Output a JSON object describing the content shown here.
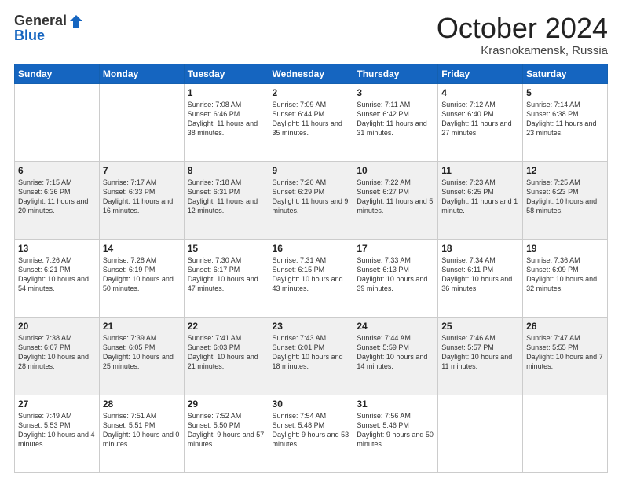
{
  "header": {
    "logo_general": "General",
    "logo_blue": "Blue",
    "month": "October 2024",
    "location": "Krasnokamensk, Russia"
  },
  "days_of_week": [
    "Sunday",
    "Monday",
    "Tuesday",
    "Wednesday",
    "Thursday",
    "Friday",
    "Saturday"
  ],
  "weeks": [
    [
      {
        "day": "",
        "sunrise": "",
        "sunset": "",
        "daylight": ""
      },
      {
        "day": "",
        "sunrise": "",
        "sunset": "",
        "daylight": ""
      },
      {
        "day": "1",
        "sunrise": "Sunrise: 7:08 AM",
        "sunset": "Sunset: 6:46 PM",
        "daylight": "Daylight: 11 hours and 38 minutes."
      },
      {
        "day": "2",
        "sunrise": "Sunrise: 7:09 AM",
        "sunset": "Sunset: 6:44 PM",
        "daylight": "Daylight: 11 hours and 35 minutes."
      },
      {
        "day": "3",
        "sunrise": "Sunrise: 7:11 AM",
        "sunset": "Sunset: 6:42 PM",
        "daylight": "Daylight: 11 hours and 31 minutes."
      },
      {
        "day": "4",
        "sunrise": "Sunrise: 7:12 AM",
        "sunset": "Sunset: 6:40 PM",
        "daylight": "Daylight: 11 hours and 27 minutes."
      },
      {
        "day": "5",
        "sunrise": "Sunrise: 7:14 AM",
        "sunset": "Sunset: 6:38 PM",
        "daylight": "Daylight: 11 hours and 23 minutes."
      }
    ],
    [
      {
        "day": "6",
        "sunrise": "Sunrise: 7:15 AM",
        "sunset": "Sunset: 6:36 PM",
        "daylight": "Daylight: 11 hours and 20 minutes."
      },
      {
        "day": "7",
        "sunrise": "Sunrise: 7:17 AM",
        "sunset": "Sunset: 6:33 PM",
        "daylight": "Daylight: 11 hours and 16 minutes."
      },
      {
        "day": "8",
        "sunrise": "Sunrise: 7:18 AM",
        "sunset": "Sunset: 6:31 PM",
        "daylight": "Daylight: 11 hours and 12 minutes."
      },
      {
        "day": "9",
        "sunrise": "Sunrise: 7:20 AM",
        "sunset": "Sunset: 6:29 PM",
        "daylight": "Daylight: 11 hours and 9 minutes."
      },
      {
        "day": "10",
        "sunrise": "Sunrise: 7:22 AM",
        "sunset": "Sunset: 6:27 PM",
        "daylight": "Daylight: 11 hours and 5 minutes."
      },
      {
        "day": "11",
        "sunrise": "Sunrise: 7:23 AM",
        "sunset": "Sunset: 6:25 PM",
        "daylight": "Daylight: 11 hours and 1 minute."
      },
      {
        "day": "12",
        "sunrise": "Sunrise: 7:25 AM",
        "sunset": "Sunset: 6:23 PM",
        "daylight": "Daylight: 10 hours and 58 minutes."
      }
    ],
    [
      {
        "day": "13",
        "sunrise": "Sunrise: 7:26 AM",
        "sunset": "Sunset: 6:21 PM",
        "daylight": "Daylight: 10 hours and 54 minutes."
      },
      {
        "day": "14",
        "sunrise": "Sunrise: 7:28 AM",
        "sunset": "Sunset: 6:19 PM",
        "daylight": "Daylight: 10 hours and 50 minutes."
      },
      {
        "day": "15",
        "sunrise": "Sunrise: 7:30 AM",
        "sunset": "Sunset: 6:17 PM",
        "daylight": "Daylight: 10 hours and 47 minutes."
      },
      {
        "day": "16",
        "sunrise": "Sunrise: 7:31 AM",
        "sunset": "Sunset: 6:15 PM",
        "daylight": "Daylight: 10 hours and 43 minutes."
      },
      {
        "day": "17",
        "sunrise": "Sunrise: 7:33 AM",
        "sunset": "Sunset: 6:13 PM",
        "daylight": "Daylight: 10 hours and 39 minutes."
      },
      {
        "day": "18",
        "sunrise": "Sunrise: 7:34 AM",
        "sunset": "Sunset: 6:11 PM",
        "daylight": "Daylight: 10 hours and 36 minutes."
      },
      {
        "day": "19",
        "sunrise": "Sunrise: 7:36 AM",
        "sunset": "Sunset: 6:09 PM",
        "daylight": "Daylight: 10 hours and 32 minutes."
      }
    ],
    [
      {
        "day": "20",
        "sunrise": "Sunrise: 7:38 AM",
        "sunset": "Sunset: 6:07 PM",
        "daylight": "Daylight: 10 hours and 28 minutes."
      },
      {
        "day": "21",
        "sunrise": "Sunrise: 7:39 AM",
        "sunset": "Sunset: 6:05 PM",
        "daylight": "Daylight: 10 hours and 25 minutes."
      },
      {
        "day": "22",
        "sunrise": "Sunrise: 7:41 AM",
        "sunset": "Sunset: 6:03 PM",
        "daylight": "Daylight: 10 hours and 21 minutes."
      },
      {
        "day": "23",
        "sunrise": "Sunrise: 7:43 AM",
        "sunset": "Sunset: 6:01 PM",
        "daylight": "Daylight: 10 hours and 18 minutes."
      },
      {
        "day": "24",
        "sunrise": "Sunrise: 7:44 AM",
        "sunset": "Sunset: 5:59 PM",
        "daylight": "Daylight: 10 hours and 14 minutes."
      },
      {
        "day": "25",
        "sunrise": "Sunrise: 7:46 AM",
        "sunset": "Sunset: 5:57 PM",
        "daylight": "Daylight: 10 hours and 11 minutes."
      },
      {
        "day": "26",
        "sunrise": "Sunrise: 7:47 AM",
        "sunset": "Sunset: 5:55 PM",
        "daylight": "Daylight: 10 hours and 7 minutes."
      }
    ],
    [
      {
        "day": "27",
        "sunrise": "Sunrise: 7:49 AM",
        "sunset": "Sunset: 5:53 PM",
        "daylight": "Daylight: 10 hours and 4 minutes."
      },
      {
        "day": "28",
        "sunrise": "Sunrise: 7:51 AM",
        "sunset": "Sunset: 5:51 PM",
        "daylight": "Daylight: 10 hours and 0 minutes."
      },
      {
        "day": "29",
        "sunrise": "Sunrise: 7:52 AM",
        "sunset": "Sunset: 5:50 PM",
        "daylight": "Daylight: 9 hours and 57 minutes."
      },
      {
        "day": "30",
        "sunrise": "Sunrise: 7:54 AM",
        "sunset": "Sunset: 5:48 PM",
        "daylight": "Daylight: 9 hours and 53 minutes."
      },
      {
        "day": "31",
        "sunrise": "Sunrise: 7:56 AM",
        "sunset": "Sunset: 5:46 PM",
        "daylight": "Daylight: 9 hours and 50 minutes."
      },
      {
        "day": "",
        "sunrise": "",
        "sunset": "",
        "daylight": ""
      },
      {
        "day": "",
        "sunrise": "",
        "sunset": "",
        "daylight": ""
      }
    ]
  ]
}
